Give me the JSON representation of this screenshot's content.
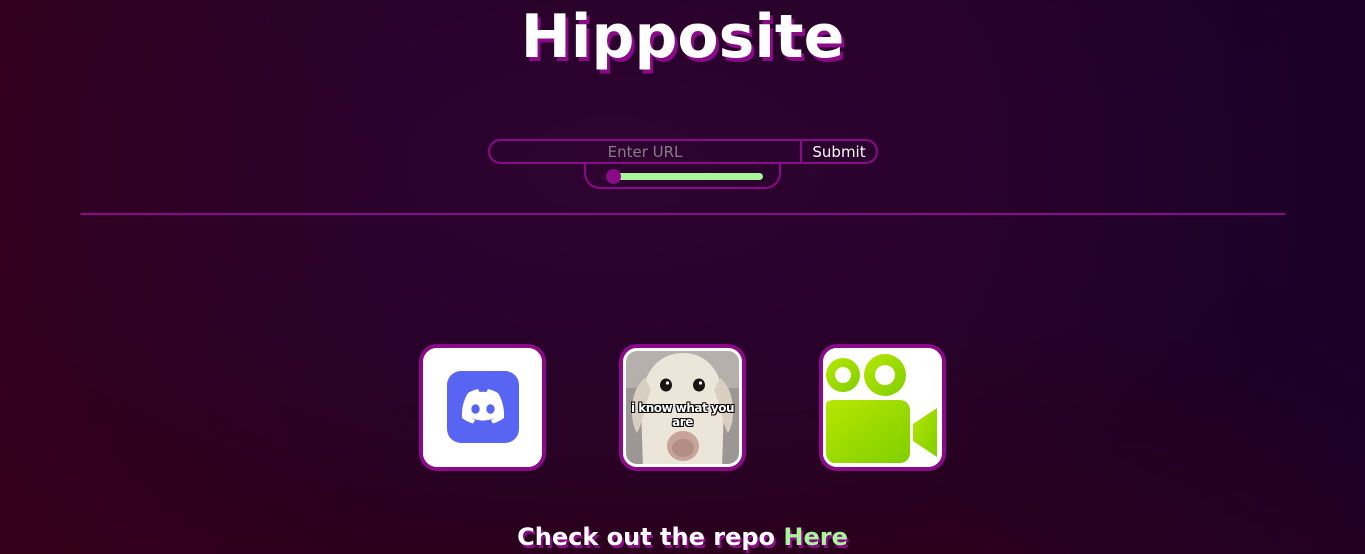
{
  "header": {
    "title": "Hipposite"
  },
  "url_form": {
    "placeholder": "Enter URL",
    "value": "",
    "submit_label": "Submit"
  },
  "slider": {
    "value_fraction": 0.0
  },
  "tiles": [
    {
      "name": "discord",
      "icon": "discord-logo-icon"
    },
    {
      "name": "meme",
      "icon": "dog-meme-image",
      "caption": "i know what you are"
    },
    {
      "name": "video",
      "icon": "video-camera-icon"
    }
  ],
  "footer": {
    "text": "Check out the repo",
    "link_label": "Here"
  },
  "colors": {
    "accent": "#8a0a8a",
    "highlight": "#a8f59a",
    "discord": "#5865f2",
    "video_green": "#a0e000"
  }
}
